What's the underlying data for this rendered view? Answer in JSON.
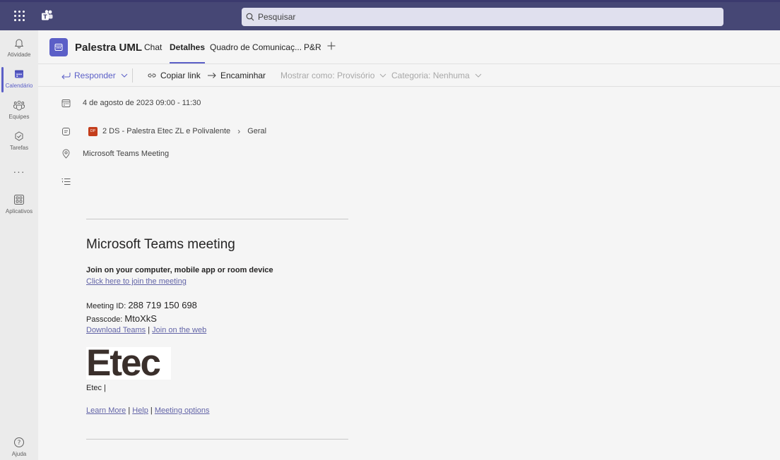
{
  "titlebar": {
    "search_placeholder": "Pesquisar"
  },
  "rail": {
    "items": [
      {
        "label": "Atividade"
      },
      {
        "label": "Calendário"
      },
      {
        "label": "Equipes"
      },
      {
        "label": "Tarefas"
      },
      {
        "label": "Aplicativos"
      },
      {
        "label": "Ajuda"
      }
    ],
    "more": "···"
  },
  "header": {
    "title": "Palestra UML",
    "tabs": [
      {
        "label": "Chat"
      },
      {
        "label": "Detalhes"
      },
      {
        "label": "Quadro de Comunicaç..."
      },
      {
        "label": "P&R"
      }
    ]
  },
  "toolbar": {
    "reply": "Responder",
    "copy_link": "Copiar link",
    "forward": "Encaminhar",
    "show_as": "Mostrar como: Provisório",
    "category": "Categoria: Nenhuma"
  },
  "details": {
    "datetime": "4 de agosto de 2023 09:00 - 11:30",
    "team_avatar": "DP",
    "team": "2 DS - Palestra Etec ZL e Polivalente",
    "channel": "Geral",
    "location": "Microsoft Teams Meeting"
  },
  "body": {
    "title": "Microsoft Teams meeting",
    "join_heading": "Join on your computer, mobile app or room device",
    "join_link": "Click here to join the meeting",
    "meeting_id_label": "Meeting ID: ",
    "meeting_id": "288 719 150 698",
    "passcode_label": "Passcode: ",
    "passcode": "MtoXkS",
    "download_teams": "Download Teams",
    "join_web": "Join on the web",
    "separator": " | ",
    "logo_text": "Etec",
    "signature": "Etec |",
    "learn_more": "Learn More",
    "help": "Help",
    "meeting_options": "Meeting options"
  },
  "colors": {
    "titlebar": "#464775",
    "accent": "#5b5fc7",
    "link": "#6264a7",
    "team_avatar": "#c43e1c"
  }
}
